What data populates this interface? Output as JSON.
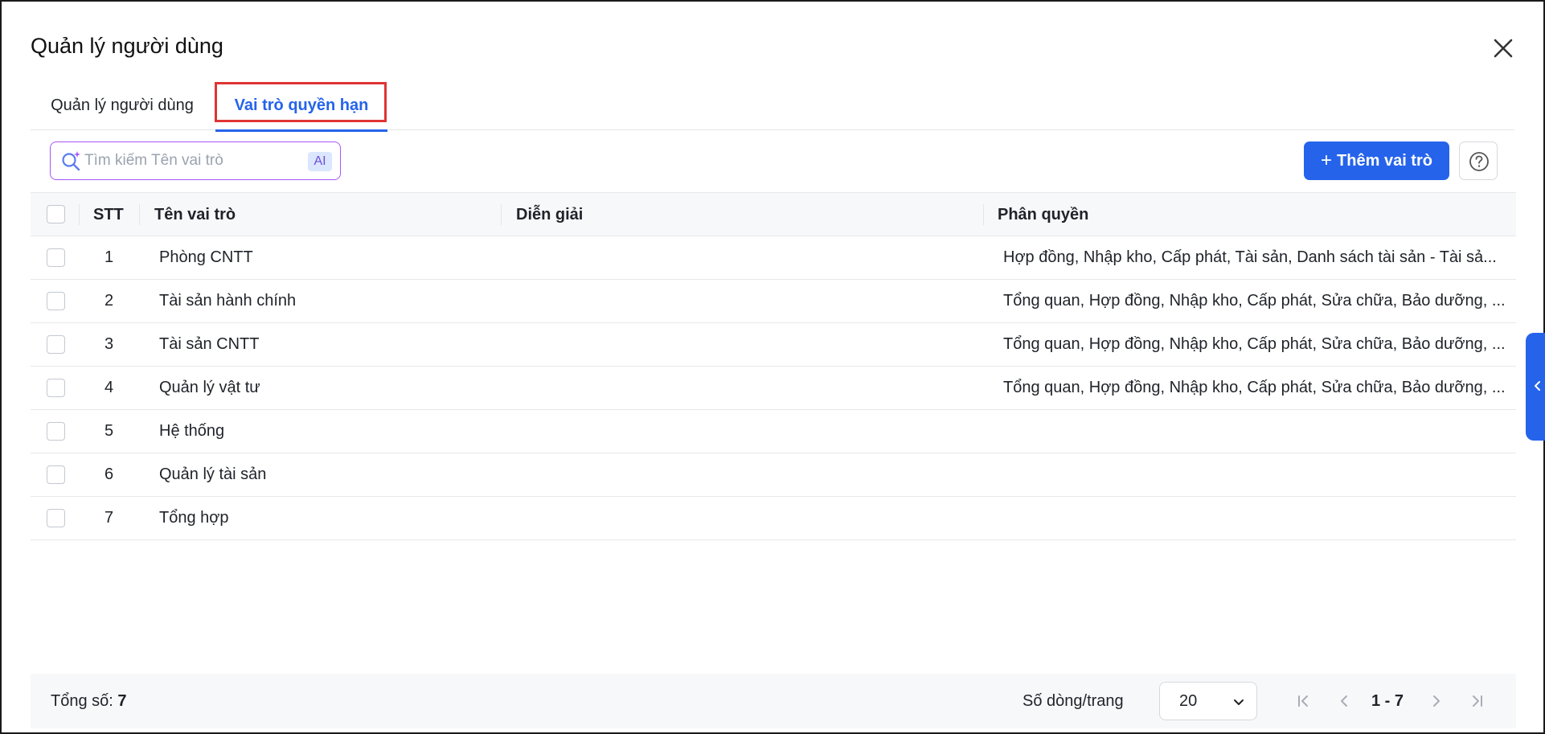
{
  "dialog": {
    "title": "Quản lý người dùng"
  },
  "tabs": [
    {
      "label": "Quản lý người dùng",
      "active": false
    },
    {
      "label": "Vai trò quyền hạn",
      "active": true
    }
  ],
  "toolbar": {
    "search_placeholder": "Tìm kiếm Tên vai trò",
    "ai_badge": "AI",
    "add_label": "Thêm vai trò",
    "accent_color": "#2563eb"
  },
  "table": {
    "columns": [
      "STT",
      "Tên vai trò",
      "Diễn giải",
      "Phân quyền"
    ],
    "rows": [
      {
        "stt": "1",
        "name": "Phòng CNTT",
        "desc": "",
        "perm": "Hợp đồng, Nhập kho, Cấp phát, Tài sản, Danh sách tài sản - Tài sả..."
      },
      {
        "stt": "2",
        "name": "Tài sản hành chính",
        "desc": "",
        "perm": "Tổng quan, Hợp đồng, Nhập kho, Cấp phát, Sửa chữa, Bảo dưỡng, ..."
      },
      {
        "stt": "3",
        "name": "Tài sản CNTT",
        "desc": "",
        "perm": "Tổng quan, Hợp đồng, Nhập kho, Cấp phát, Sửa chữa, Bảo dưỡng, ..."
      },
      {
        "stt": "4",
        "name": "Quản lý vật tư",
        "desc": "",
        "perm": "Tổng quan, Hợp đồng, Nhập kho, Cấp phát, Sửa chữa, Bảo dưỡng, ..."
      },
      {
        "stt": "5",
        "name": "Hệ thống",
        "desc": "",
        "perm": ""
      },
      {
        "stt": "6",
        "name": "Quản lý tài sản",
        "desc": "",
        "perm": ""
      },
      {
        "stt": "7",
        "name": "Tổng hợp",
        "desc": "",
        "perm": ""
      }
    ]
  },
  "footer": {
    "total_label": "Tổng số:",
    "total_value": "7",
    "rows_per_page_label": "Số dòng/trang",
    "rows_per_page_value": "20",
    "range": "1 - 7"
  }
}
